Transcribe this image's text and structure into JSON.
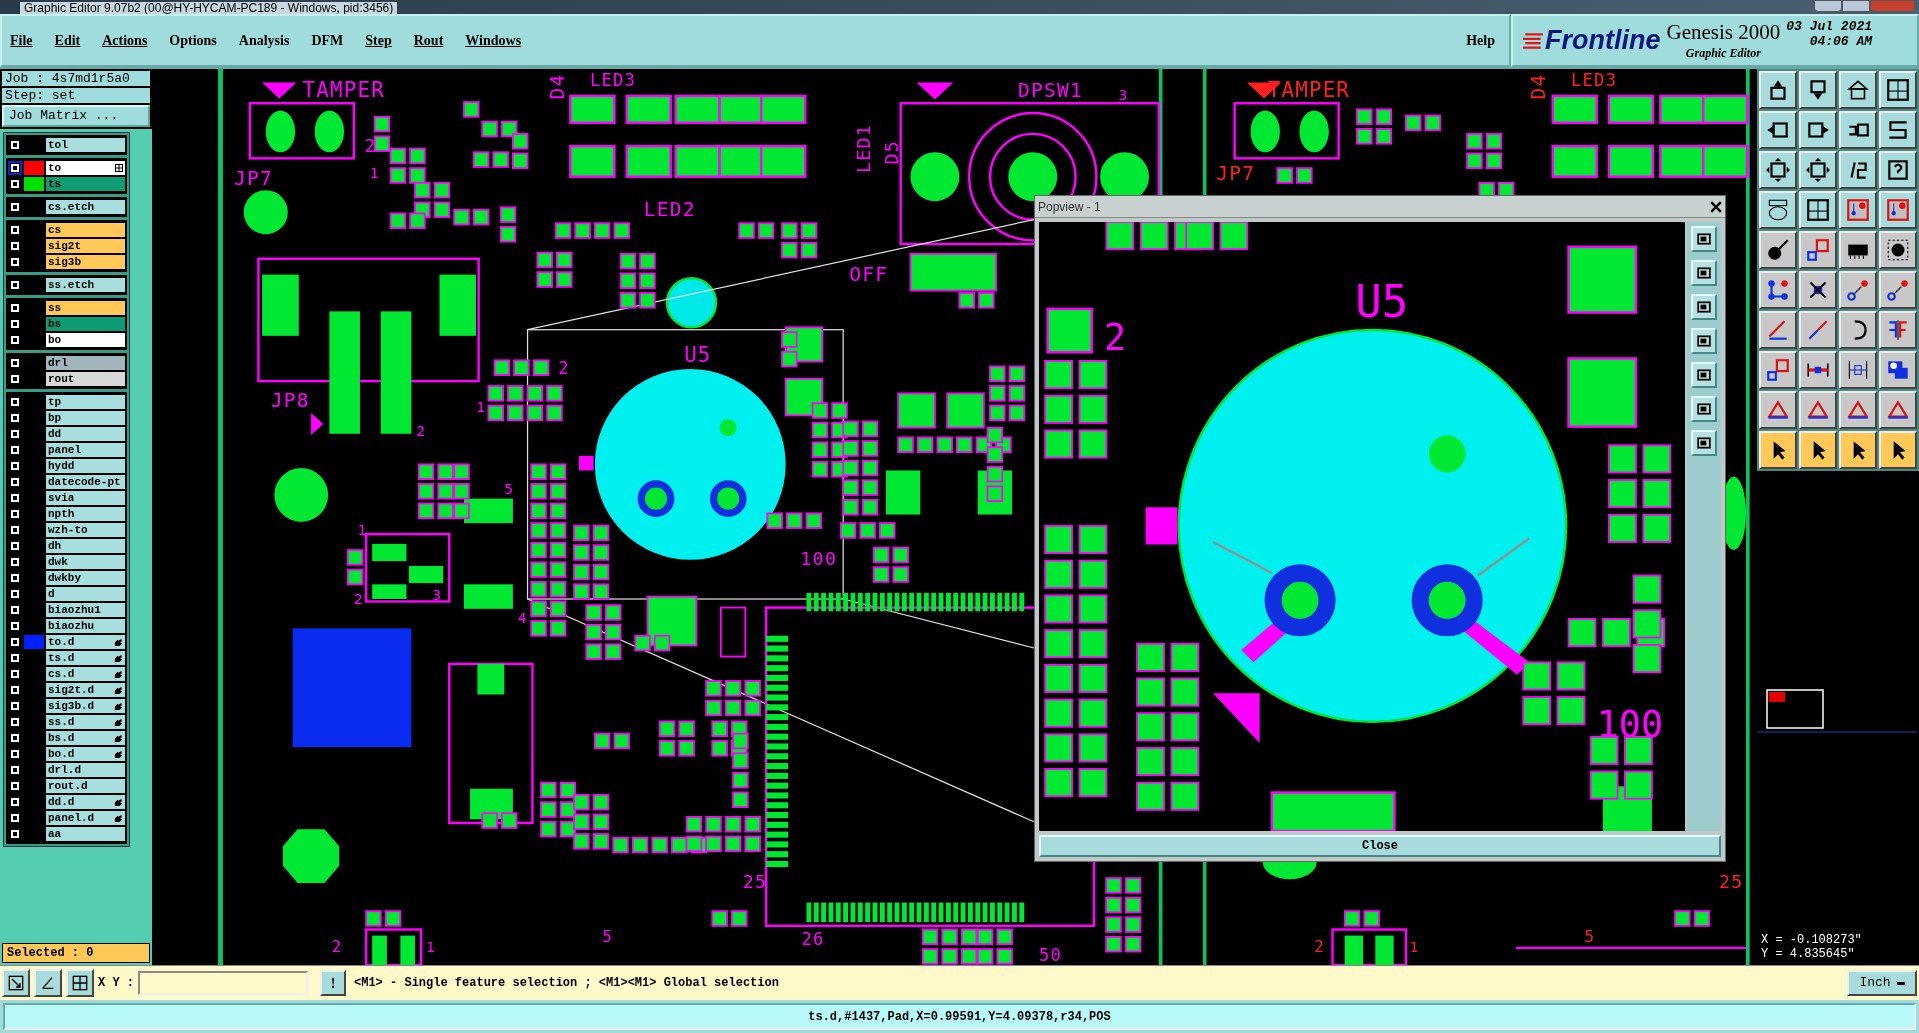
{
  "title_bar": {
    "title": "Graphic Editor 9.07b2 (00@HY-HYCAM-PC189 - Windows, pid:3456)"
  },
  "menu": [
    {
      "label": "File",
      "underlined": true
    },
    {
      "label": "Edit",
      "underlined": true
    },
    {
      "label": "Actions",
      "underlined": true
    },
    {
      "label": "Options",
      "underlined": false
    },
    {
      "label": "Analysis",
      "underlined": false
    },
    {
      "label": "DFM",
      "underlined": false
    },
    {
      "label": "Step",
      "underlined": true
    },
    {
      "label": "Rout",
      "underlined": true
    },
    {
      "label": "Windows",
      "underlined": true
    }
  ],
  "help": "Help",
  "brand": {
    "logo": "Frontline",
    "product": "Genesis 2000",
    "subtitle": "Graphic Editor",
    "date": "03 Jul 2021",
    "time": "04:06 AM"
  },
  "job": {
    "job": "Job : 4s7md1r5a0",
    "step": "Step: set",
    "matrix_button": "Job Matrix ..."
  },
  "layer_groups": [
    [
      {
        "name": "tol",
        "kind": "misc"
      }
    ],
    [
      {
        "name": "to",
        "kind": "silk",
        "color": "#ff0000",
        "selected": true
      },
      {
        "name": "ts",
        "kind": "mask",
        "color": "#00e000",
        "selected": false
      }
    ],
    [
      {
        "name": "cs.etch",
        "kind": "misc"
      }
    ],
    [
      {
        "name": "cs",
        "kind": "signal"
      },
      {
        "name": "sig2t",
        "kind": "signal"
      },
      {
        "name": "sig3b",
        "kind": "signal"
      }
    ],
    [
      {
        "name": "ss.etch",
        "kind": "misc"
      }
    ],
    [
      {
        "name": "ss",
        "kind": "signal"
      },
      {
        "name": "bs",
        "kind": "mask"
      },
      {
        "name": "bo",
        "kind": "silk"
      }
    ],
    [
      {
        "name": "drl",
        "kind": "drill"
      },
      {
        "name": "rout",
        "kind": "rout"
      }
    ],
    [
      {
        "name": "tp",
        "kind": "misc"
      },
      {
        "name": "bp",
        "kind": "misc"
      },
      {
        "name": "dd",
        "kind": "misc"
      },
      {
        "name": "panel",
        "kind": "misc"
      },
      {
        "name": "hydd",
        "kind": "misc"
      },
      {
        "name": "datecode-pt",
        "kind": "misc"
      },
      {
        "name": "svia",
        "kind": "misc"
      },
      {
        "name": "npth",
        "kind": "misc"
      },
      {
        "name": "wzh-to",
        "kind": "misc"
      },
      {
        "name": "dh",
        "kind": "misc"
      },
      {
        "name": "dwk",
        "kind": "misc"
      },
      {
        "name": "dwkby",
        "kind": "misc"
      },
      {
        "name": "d",
        "kind": "misc"
      },
      {
        "name": "biaozhu1",
        "kind": "misc"
      },
      {
        "name": "biaozhu",
        "kind": "misc"
      },
      {
        "name": "to.d",
        "kind": "misc",
        "color": "#0020ff",
        "marked": true
      },
      {
        "name": "ts.d",
        "kind": "misc",
        "marked": true
      },
      {
        "name": "cs.d",
        "kind": "misc",
        "marked": true
      },
      {
        "name": "sig2t.d",
        "kind": "misc",
        "marked": true
      },
      {
        "name": "sig3b.d",
        "kind": "misc",
        "marked": true
      },
      {
        "name": "ss.d",
        "kind": "misc",
        "marked": true
      },
      {
        "name": "bs.d",
        "kind": "misc",
        "marked": true
      },
      {
        "name": "bo.d",
        "kind": "misc",
        "marked": true
      },
      {
        "name": "drl.d",
        "kind": "misc",
        "marked": false
      },
      {
        "name": "rout.d",
        "kind": "misc",
        "marked": false
      },
      {
        "name": "dd.d",
        "kind": "misc",
        "marked": true
      },
      {
        "name": "panel.d",
        "kind": "misc",
        "marked": true
      },
      {
        "name": "aa",
        "kind": "misc",
        "marked": false
      }
    ]
  ],
  "selected_count": "Selected : 0",
  "canvas": {
    "labels": [
      {
        "text": "TAMPER",
        "color": "#ff00ff"
      },
      {
        "text": "JP7",
        "color": "#ff00ff"
      },
      {
        "text": "LED3",
        "color": "#ff00ff"
      },
      {
        "text": "D4",
        "color": "#ff00ff"
      },
      {
        "text": "LED1",
        "color": "#ff00ff"
      },
      {
        "text": "D5",
        "color": "#ff00ff"
      },
      {
        "text": "DPSW1",
        "color": "#ff00ff"
      },
      {
        "text": "LED2",
        "color": "#ff00ff"
      },
      {
        "text": "OFF",
        "color": "#ff00ff"
      },
      {
        "text": "JP8",
        "color": "#ff00ff"
      },
      {
        "text": "U5",
        "color": "#ff00ff"
      },
      {
        "text": "100",
        "color": "#ff00ff"
      },
      {
        "text": "5",
        "color": "#ff00ff"
      },
      {
        "text": "4",
        "color": "#ff00ff"
      },
      {
        "text": "1",
        "color": "#ff00ff"
      },
      {
        "text": "2",
        "color": "#ff00ff"
      },
      {
        "text": "3",
        "color": "#ff00ff"
      },
      {
        "text": "25",
        "color": "#ff00ff"
      },
      {
        "text": "26",
        "color": "#ff00ff"
      },
      {
        "text": "50",
        "color": "#ff00ff"
      },
      {
        "text": "5",
        "color": "#ff00ff"
      },
      {
        "text": "2",
        "color": "#ff00ff"
      },
      {
        "text": "1",
        "color": "#ff00ff"
      },
      {
        "text": "3",
        "color": "#ff00ff"
      },
      {
        "text": "2",
        "color": "#ff00ff"
      },
      {
        "text": "1",
        "color": "#ff00ff"
      },
      {
        "text": "2",
        "color": "#ff00ff"
      },
      {
        "text": "1",
        "color": "#ff00ff"
      },
      {
        "text": "2",
        "color": "#ff00ff"
      },
      {
        "text": "TAMPER",
        "color": "#ff2020"
      },
      {
        "text": "JP7",
        "color": "#ff2020"
      },
      {
        "text": "LED3",
        "color": "#ff2020"
      },
      {
        "text": "D4",
        "color": "#ff2020"
      },
      {
        "text": "25",
        "color": "#ff2020"
      },
      {
        "text": "5",
        "color": "#ff2020"
      },
      {
        "text": "2",
        "color": "#ff2020"
      },
      {
        "text": "1",
        "color": "#ff2020"
      }
    ]
  },
  "popview": {
    "title": "Popview - 1",
    "labels": [
      "U5",
      "2",
      "100"
    ],
    "close_button": "Close"
  },
  "coordinates": {
    "x": "X = -0.108273\"",
    "y": "Y = 4.835645\""
  },
  "bottom_bar": {
    "xy_label": "X Y :",
    "alert_button": "!",
    "hint": "<M1> - Single feature selection ; <M1><M1> Global selection",
    "units": "Inch"
  },
  "status": "ts.d,#1437,Pad,X=0.99591,Y=4.09378,r34,POS"
}
